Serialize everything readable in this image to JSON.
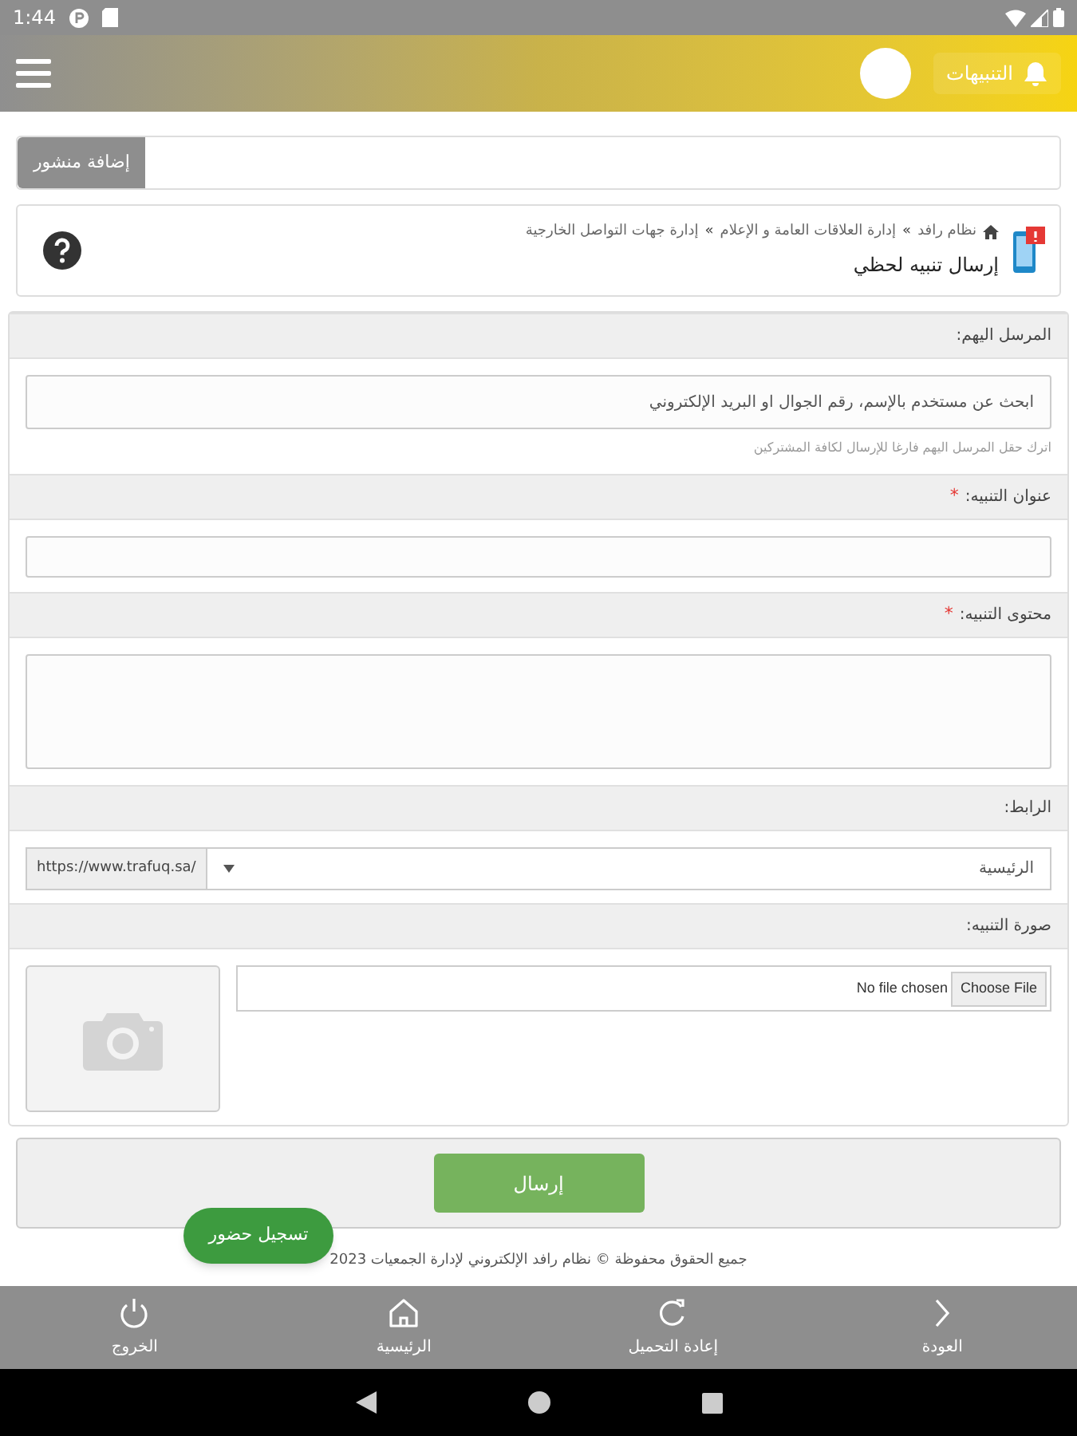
{
  "status_bar": {
    "time": "1:44"
  },
  "header": {
    "notifications_label": "التنبيهات"
  },
  "add_post_button": "إضافة منشور",
  "breadcrumb": {
    "items": [
      "نظام رافد",
      "إدارة العلاقات العامة و الإعلام",
      "إدارة جهات التواصل الخارجية"
    ],
    "separator": "»",
    "page_title": "إرسال تنبيه لحظي"
  },
  "form": {
    "sections": [
      {
        "kind": "search",
        "label": "المرسل اليهم:",
        "placeholder": "ابحث عن مستخدم بالإسم، رقم الجوال او البريد الإلكتروني",
        "hint": "اترك حقل المرسل اليهم فارغا للإرسال لكافة المشتركين"
      },
      {
        "kind": "text",
        "label": "عنوان التنبيه:",
        "required_mark": "*"
      },
      {
        "kind": "textarea",
        "label": "محتوى التنبيه:",
        "required_mark": "*"
      },
      {
        "kind": "link",
        "label": "الرابط:",
        "value": "الرئيسية",
        "prefix": "https://www.trafuq.sa/"
      },
      {
        "kind": "image",
        "label": "صورة التنبيه:",
        "file_button": "Choose File",
        "file_status": "No file chosen"
      }
    ]
  },
  "submit_button": "إرسال",
  "attendance_button": "تسجيل حضور",
  "footer": "جميع الحقوق محفوظة © نظام رافد الإلكتروني لإدارة الجمعيات 2023",
  "bottom_nav": [
    {
      "kind": "back",
      "label": "العودة"
    },
    {
      "kind": "reload",
      "label": "إعادة التحميل"
    },
    {
      "kind": "home",
      "label": "الرئيسية"
    },
    {
      "kind": "logout",
      "label": "الخروج"
    }
  ]
}
